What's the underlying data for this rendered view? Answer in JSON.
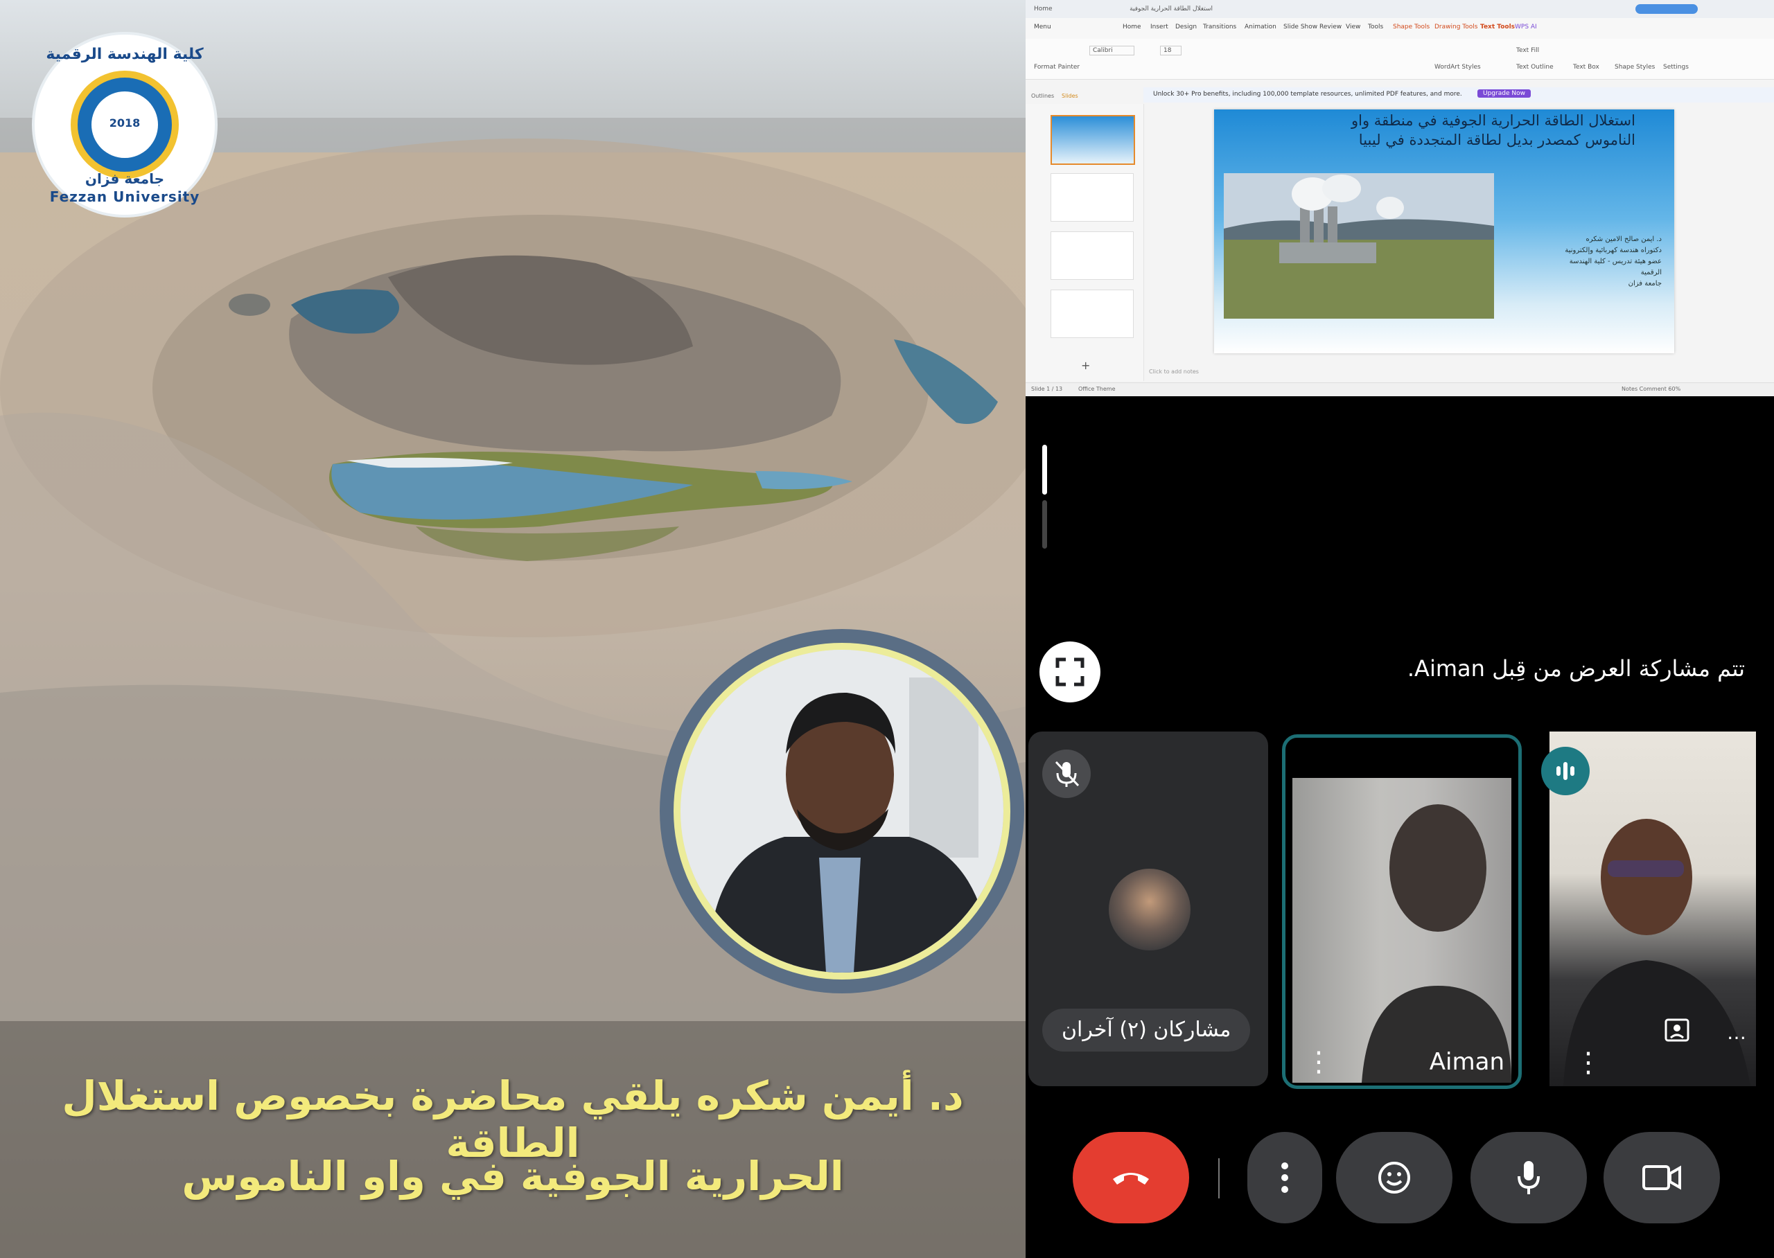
{
  "poster": {
    "logo": {
      "arabic_top": "كلية الهندسة الرقمية",
      "year": "2018",
      "arabic_bottom": "جامعة فزان",
      "english": "Fezzan University"
    },
    "caption": {
      "line1": "د. أيمن شكره يلقي محاضرة بخصوص استغلال الطاقة",
      "line2": "الحرارية الجوفية في واو الناموس"
    },
    "colors": {
      "caption_text": "#f3ea7c",
      "portrait_ring_outer": "#5a6e85",
      "portrait_ring_inner": "#ecec9a"
    }
  },
  "meeting": {
    "shared_screen": {
      "browser_tab": "استغلال الطاقة الحرارية الجوفية",
      "menu_items": [
        "Menu",
        "Home",
        "Insert",
        "Design",
        "Transitions",
        "Animation",
        "Slide Show",
        "Review",
        "View",
        "Tools",
        "Shape Tools",
        "Drawing Tools",
        "Text Tools",
        "WPS AI"
      ],
      "ribbon_items": [
        "Format Painter",
        "Calibri",
        "18",
        "WordArt Styles",
        "Text Fill",
        "Text Outline",
        "Text Box",
        "Shape Styles",
        "Settings"
      ],
      "panel_tabs": [
        "Outlines",
        "Slides"
      ],
      "banner_text": "Unlock 30+ Pro benefits, including 100,000 template resources, unlimited PDF features, and more.",
      "banner_button": "Upgrade Now",
      "slide": {
        "title_line1": "استغلال الطاقة الحرارية الجوفية في منطقة واو",
        "title_line2": "الناموس كمصدر بديل لطاقة المتجددة في ليبيا",
        "presenter_lines": [
          "د. ايمن صالح الامين شكره",
          "دكتوراه هندسة كهربائية وإلكترونية",
          "عضو هيئة تدريس - كلية الهندسة الرقمية",
          "جامعة فزان"
        ]
      },
      "notes_placeholder": "Click to add notes",
      "status_left": "Slide 1 / 13",
      "status_theme": "Office Theme",
      "status_right": "Notes   Comment   60%"
    },
    "share_notice": "تتم مشاركة العرض من قِبل Aiman.",
    "tiles": [
      {
        "label": "مشاركان (٢) آخران",
        "muted": true
      },
      {
        "label": "Aiman",
        "active_speaker": true
      },
      {
        "label": "",
        "speaking_indicator": true
      }
    ],
    "controls": {
      "end_call": "end-call",
      "more": "more-options",
      "reactions": "emoji",
      "microphone": "microphone",
      "camera": "camera"
    },
    "colors": {
      "end_call": "#e43d30",
      "active_border": "#1c6e74",
      "control_bg": "#3b3c3f"
    }
  }
}
